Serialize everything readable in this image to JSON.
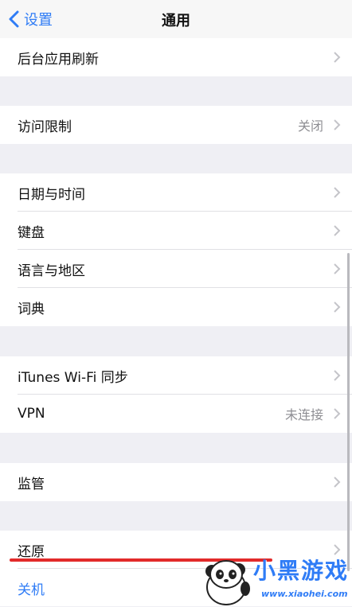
{
  "nav": {
    "back_label": "设置",
    "title": "通用"
  },
  "items": {
    "background_refresh": "后台应用刷新",
    "restrictions": {
      "label": "访问限制",
      "value": "关闭"
    },
    "date_time": "日期与时间",
    "keyboard": "键盘",
    "language_region": "语言与地区",
    "dictionary": "词典",
    "itunes_wifi_sync": "iTunes Wi-Fi 同步",
    "vpn": {
      "label": "VPN",
      "value": "未连接"
    },
    "supervision": "监管",
    "reset": "还原",
    "shutdown": "关机"
  },
  "watermark": {
    "brand": "小黑游戏",
    "url": "www.xiaohei.com"
  },
  "colors": {
    "accent": "#2f7cf6",
    "annotation": "#e22a2a",
    "background": "#efeff4"
  }
}
